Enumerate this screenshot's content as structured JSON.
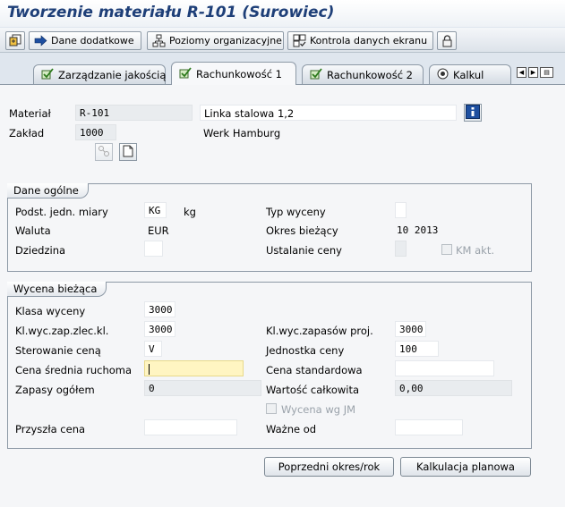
{
  "window": {
    "title": "Tworzenie materiału R-101 (Surowiec)"
  },
  "toolbar": {
    "additional_data": "Dane dodatkowe",
    "org_levels": "Poziomy organizacyjne",
    "check_screen": "Kontrola danych ekranu"
  },
  "tabs": [
    {
      "label": "Zarządzanie jakością"
    },
    {
      "label": "Rachunkowość 1"
    },
    {
      "label": "Rachunkowość 2"
    },
    {
      "label": "Kalkul"
    }
  ],
  "header": {
    "material_label": "Materiał",
    "material_value": "R-101",
    "material_desc": "Linka stalowa 1,2",
    "plant_label": "Zakład",
    "plant_value": "1000",
    "plant_desc": "Werk Hamburg"
  },
  "general": {
    "title": "Dane ogólne",
    "base_unit_label": "Podst. jedn. miary",
    "base_unit_value": "KG",
    "base_unit_text": "kg",
    "currency_label": "Waluta",
    "currency_value": "EUR",
    "division_label": "Dziedzina",
    "division_value": "",
    "valuation_type_label": "Typ wyceny",
    "valuation_type_value": "",
    "current_period_label": "Okres bieżący",
    "current_period_value": "10 2013",
    "price_determination_label": "Ustalanie ceny",
    "price_determination_value": "",
    "ml_act_label": "KM akt."
  },
  "current_valuation": {
    "title": "Wycena bieżąca",
    "valuation_class_label": "Klasa wyceny",
    "valuation_class_value": "3000",
    "vc_sales_order_label": "Kl.wyc.zap.zlec.kl.",
    "vc_sales_order_value": "3000",
    "vc_project_stock_label": "Kl.wyc.zapasów proj.",
    "vc_project_stock_value": "3000",
    "price_control_label": "Sterowanie ceną",
    "price_control_value": "V",
    "price_unit_label": "Jednostka ceny",
    "price_unit_value": "100",
    "moving_price_label": "Cena średnia ruchoma",
    "moving_price_value": "",
    "standard_price_label": "Cena standardowa",
    "standard_price_value": "",
    "total_stock_label": "Zapasy ogółem",
    "total_stock_value": "0",
    "total_value_label": "Wartość całkowita",
    "total_value_value": "0,00",
    "valuated_um_label": "Wycena wg JM",
    "future_price_label": "Przyszła cena",
    "future_price_value": "",
    "valid_from_label": "Ważne od",
    "valid_from_value": ""
  },
  "buttons": {
    "prev_period": "Poprzedni okres/rok",
    "planned_costing": "Kalkulacja planowa"
  },
  "colors": {
    "title": "#1e3f78",
    "focus_field": "#fff5c2",
    "panel_bg": "#f5f6f8"
  }
}
